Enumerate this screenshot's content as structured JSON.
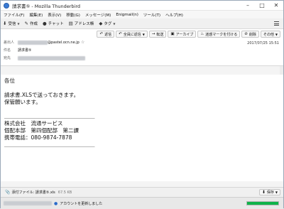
{
  "window": {
    "title": "請求書⑤ - Mozilla Thunderbird",
    "controls": [
      "–",
      "□",
      "✕"
    ]
  },
  "menu": [
    "ファイル(F)",
    "編集(E)",
    "表示(V)",
    "移動(G)",
    "メッセージ(M)",
    "Enigmail(n)",
    "ツール(T)",
    "ヘルプ(H)"
  ],
  "toolbar": {
    "receive": "受信",
    "compose": "作成",
    "chat": "チャット",
    "address_book": "アドレス帳",
    "tag": "タグ"
  },
  "actions": {
    "reply": "返信",
    "reply_all": "全員に返信",
    "forward": "転送",
    "archive": "アーカイブ",
    "junk": "迷惑マークを付ける",
    "delete": "削除",
    "other": "その他"
  },
  "header": {
    "from_label": "差出人",
    "from_domain": "@pastel.ocn.ne.jp",
    "subject_label": "件名",
    "subject": "請求書⑤",
    "to_label": "宛先",
    "date": "2017/07/25 15:51"
  },
  "body": {
    "text": "各位\n\n請求書.XLSで送っておきます。\n保管願います。\n\n＿＿＿＿＿＿＿＿＿＿＿＿＿＿＿＿＿\n株式会社　流通サービス\n個配本部　第四個配部　第二課\n携帯電話：080-9874-7878\n＿＿＿＿＿＿＿＿＿＿＿＿＿＿＿＿＿"
  },
  "attachment": {
    "label": "添付ファイル: 請求書⑤.xls",
    "size": "67.5 KB",
    "save": "保存"
  },
  "status": {
    "text": "アカウントを更新しました",
    "progress": 1.0,
    "progress_color": "#0fb34a"
  }
}
